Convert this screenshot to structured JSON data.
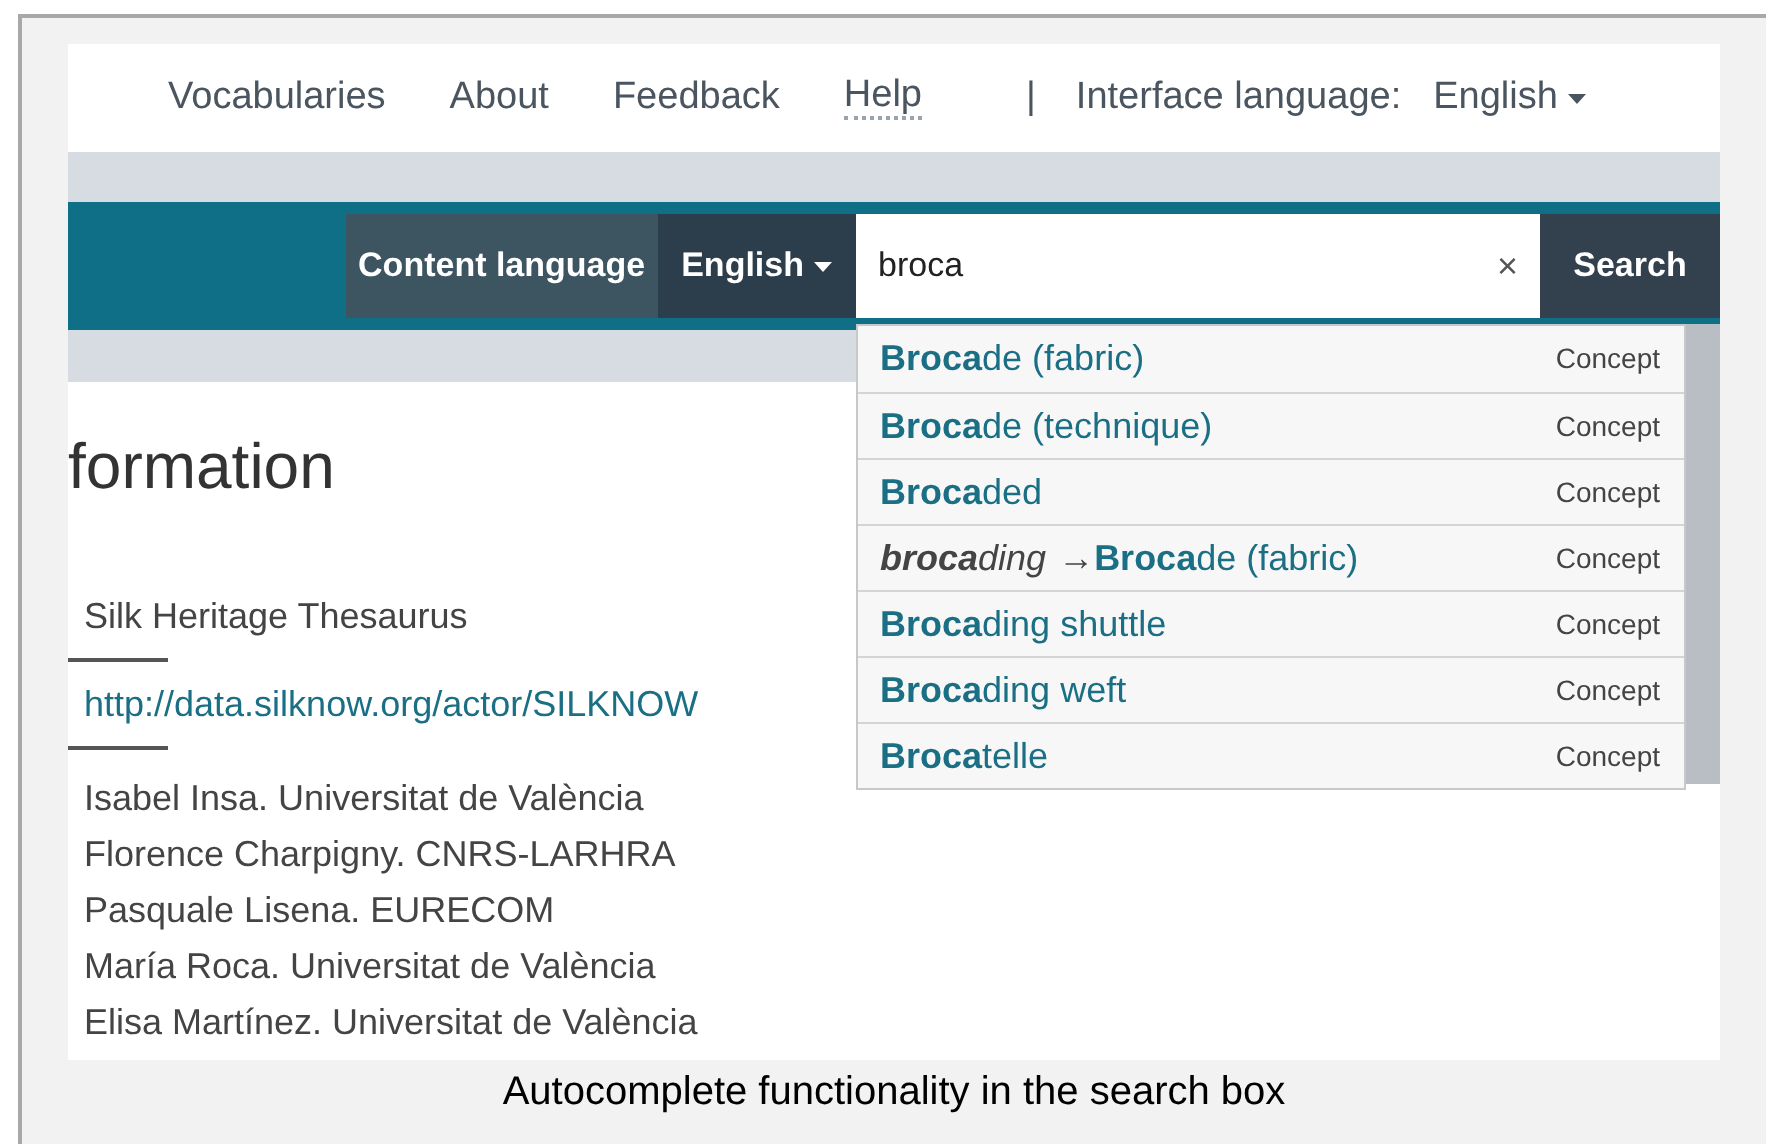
{
  "nav": {
    "links": [
      {
        "kind": "plain",
        "label": "Vocabularies"
      },
      {
        "kind": "plain",
        "label": "About"
      },
      {
        "kind": "plain",
        "label": "Feedback"
      },
      {
        "kind": "dotted",
        "label": "Help"
      }
    ],
    "separator": "|",
    "interface_language_label": "Interface language:",
    "interface_language": "English"
  },
  "search_bar": {
    "content_language_label": "Content language",
    "content_language": "English",
    "query": "broca",
    "clear": "×",
    "button": "Search"
  },
  "suggestions": [
    {
      "kind": "preferred",
      "label": "**Broca**de (fabric)",
      "type": "Concept"
    },
    {
      "kind": "preferred",
      "label": "**Broca**de (technique)",
      "type": "Concept"
    },
    {
      "kind": "preferred",
      "label": "**Broca**ded",
      "type": "Concept"
    },
    {
      "kind": "alternative",
      "label": "**broca**ding",
      "arrow": "→",
      "target": "**Broca**de (fabric)",
      "type": "Concept"
    },
    {
      "kind": "preferred",
      "label": "**Broca**ding shuttle",
      "type": "Concept"
    },
    {
      "kind": "preferred",
      "label": "**Broca**ding weft",
      "type": "Concept"
    },
    {
      "kind": "preferred",
      "label": "**Broca**telle",
      "type": "Concept"
    }
  ],
  "content": {
    "heading": "formation",
    "vocabulary": "Silk Heritage Thesaurus",
    "uri": "http://data.silknow.org/actor/SILKNOW",
    "contributors": [
      "Isabel Insa. Universitat de València",
      "Florence Charpigny. CNRS-LARHRA",
      "Pasquale Lisena. EURECOM",
      "María Roca. Universitat de València",
      "Elisa Martínez. Universitat de València"
    ]
  },
  "caption": "Autocomplete functionality in the search box"
}
